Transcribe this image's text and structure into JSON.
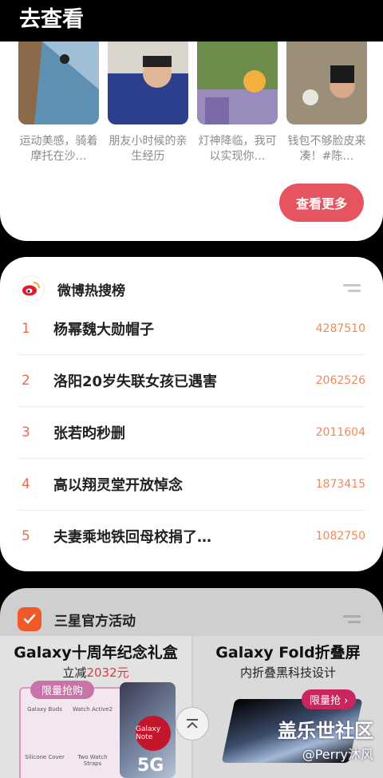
{
  "header": {
    "title": "去查看"
  },
  "videos": {
    "captions": [
      "运动美感，骑着摩托在沙…",
      "朋友小时候的亲生经历",
      "灯神降临，我可以实现你…",
      "钱包不够脸皮来凑！#陈…"
    ],
    "more_label": "查看更多"
  },
  "weibo": {
    "title": "微博热搜榜",
    "items": [
      {
        "rank": "1",
        "title": "杨幂魏大勋帽子",
        "count": "4287510"
      },
      {
        "rank": "2",
        "title": "洛阳20岁失联女孩已遇害",
        "count": "2062526"
      },
      {
        "rank": "3",
        "title": "张若昀秒删",
        "count": "2011604"
      },
      {
        "rank": "4",
        "title": "高以翔灵堂开放悼念",
        "count": "1873415"
      },
      {
        "rank": "5",
        "title": "夫妻乘地铁回母校捐了…",
        "count": "1082750"
      }
    ]
  },
  "samsung": {
    "title": "三星官方活动",
    "left_promo": {
      "headline": "Galaxy十周年纪念礼盒",
      "sub_prefix": "立减",
      "sub_amount": "2032元",
      "badge": "限量抢购",
      "items": [
        "Galaxy Buds",
        "Watch Active2",
        "Silicone Cover",
        "Two Watch Straps"
      ],
      "item_5g": "5G",
      "heart_text": "Galaxy Note"
    },
    "right_promo": {
      "headline": "Galaxy Fold折叠屏",
      "sub": "内折叠黑科技设计",
      "badge": "限量抢 ›"
    }
  },
  "watermark": {
    "main": "盖乐世社区",
    "sub": "@Perry沐风"
  },
  "colors": {
    "accent": "#e6545f",
    "rank": "#ea6a4f",
    "count": "#ee8a5a",
    "samsung_orange": "#f05a28"
  }
}
